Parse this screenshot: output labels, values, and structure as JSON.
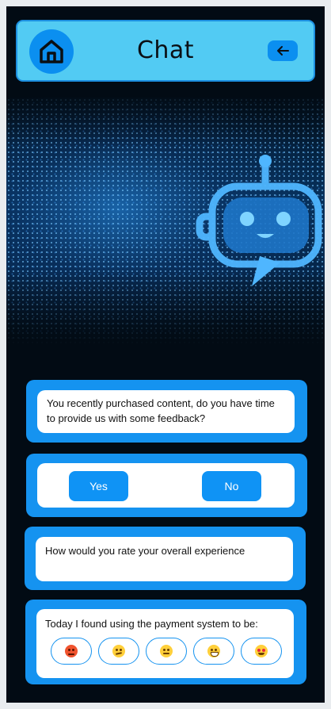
{
  "header": {
    "title": "Chat",
    "home_icon": "home-icon",
    "back_icon": "arrow-left-icon"
  },
  "banner": {
    "image": "robot-chatbot-illustration"
  },
  "messages": {
    "intro": "You recently purchased content, do you have time to provide us with some feedback?",
    "yes_label": "Yes",
    "no_label": "No",
    "rate_question": "How would you rate your overall experience",
    "payment_prompt": "Today I found using the payment system to be:"
  },
  "ratings": [
    {
      "name": "angry-face-icon"
    },
    {
      "name": "confused-face-icon"
    },
    {
      "name": "neutral-face-icon"
    },
    {
      "name": "smiling-face-icon"
    },
    {
      "name": "heart-eyes-face-icon"
    }
  ],
  "colors": {
    "accent": "#1593f0",
    "header_bg": "#52cbf3",
    "background": "#020b14"
  }
}
